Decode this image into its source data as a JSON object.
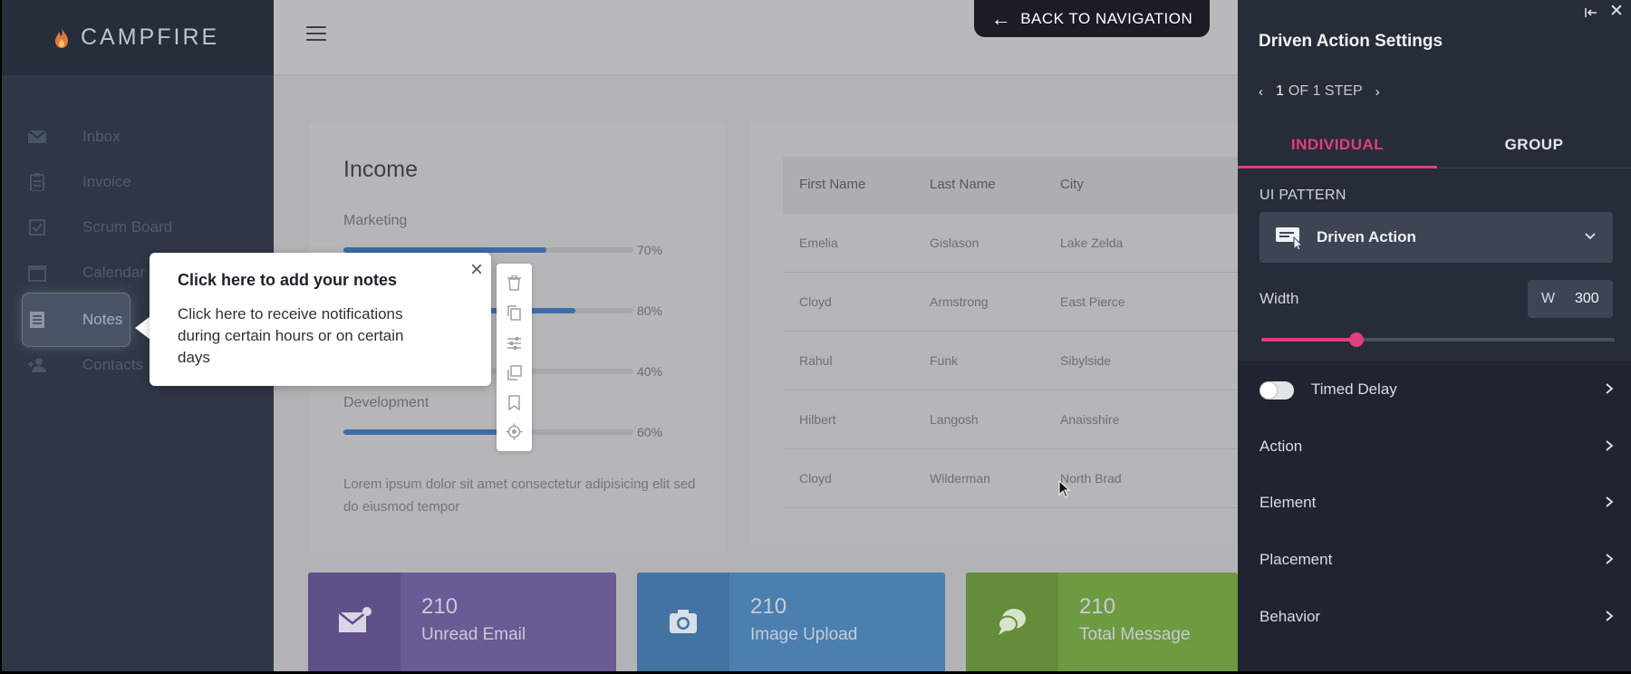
{
  "colors": {
    "accent_pink": "#e03f7d",
    "progress_blue": "#3f6ca6",
    "stat_email": "#6a5a96",
    "stat_image": "#4a7fb0",
    "stat_message": "#6e9a42"
  },
  "sidebar": {
    "logo": "CAMPFIRE",
    "items": [
      {
        "label": "Inbox",
        "icon": "mail-icon"
      },
      {
        "label": "Invoice",
        "icon": "clipboard-icon"
      },
      {
        "label": "Scrum Board",
        "icon": "checkbox-icon"
      },
      {
        "label": "Calendar",
        "icon": "calendar-icon"
      },
      {
        "label": "Notes",
        "icon": "notes-icon"
      },
      {
        "label": "Contacts",
        "icon": "add-contact-icon"
      }
    ]
  },
  "header": {
    "back_label": "BACK TO NAVIGATION"
  },
  "income": {
    "title": "Income",
    "bars": [
      {
        "label": "Marketing",
        "value": 0.7,
        "pct": "70%"
      },
      {
        "label": "",
        "value": 0.8,
        "pct": "80%"
      },
      {
        "label": "",
        "value": 0.4,
        "pct": "40%"
      },
      {
        "label": "Development",
        "value": 0.6,
        "pct": "60%"
      }
    ],
    "description": "Lorem ipsum dolor sit amet consectetur adipisicing elit sed do eiusmod tempor"
  },
  "table": {
    "columns": [
      "First Name",
      "Last Name",
      "City"
    ],
    "rows": [
      [
        "Emelia",
        "Gislason",
        "Lake Zelda"
      ],
      [
        "Cloyd",
        "Armstrong",
        "East Pierce"
      ],
      [
        "Rahul",
        "Funk",
        "Sibylside"
      ],
      [
        "Hilbert",
        "Langosh",
        "Anaisshire"
      ],
      [
        "Cloyd",
        "Wilderman",
        "North Brad"
      ]
    ]
  },
  "stats": [
    {
      "number": "210",
      "label": "Unread Email",
      "icon": "email-badge-icon"
    },
    {
      "number": "210",
      "label": "Image Upload",
      "icon": "camera-icon"
    },
    {
      "number": "210",
      "label": "Total Message",
      "icon": "chat-bubbles-icon"
    }
  ],
  "tooltip": {
    "title": "Click here to add your notes",
    "body": "Click here to receive notifications during certain hours or on certain days",
    "close": "×"
  },
  "panel": {
    "title": "Driven Action Settings",
    "step_current": "1",
    "step_of": "OF 1 STEP",
    "tabs": [
      "INDIVIDUAL",
      "GROUP"
    ],
    "ui_pattern_label": "UI PATTERN",
    "ui_pattern_value": "Driven Action",
    "width_label": "Width",
    "width_prefix": "W",
    "width_value": "300",
    "width_slider_value": 0.27,
    "timed_delay_label": "Timed Delay",
    "rows": [
      "Action",
      "Element",
      "Placement",
      "Behavior"
    ]
  }
}
